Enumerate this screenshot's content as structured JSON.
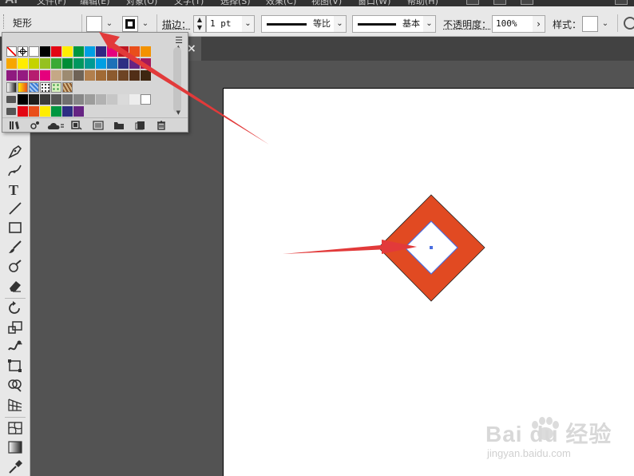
{
  "menubar": {
    "app_logo": "Ai",
    "items": [
      "文件(F)",
      "编辑(E)",
      "对象(O)",
      "文字(T)",
      "选择(S)",
      "效果(C)",
      "视图(V)",
      "窗口(W)",
      "帮助(H)"
    ]
  },
  "controlbar": {
    "tool_name": "矩形",
    "fill_color": "#ffffff",
    "stroke_label": "描边：",
    "stroke_weight": "1 pt",
    "profile_label": "等比",
    "brush_label": "基本",
    "opacity_label": "不透明度：",
    "opacity_value": "100%",
    "style_label": "样式："
  },
  "doc_tab": {
    "close_glyph": "×"
  },
  "tools": [
    "pen-tool-icon",
    "curvature-tool-icon",
    "type-tool-icon",
    "line-tool-icon",
    "rectangle-tool-icon",
    "paintbrush-tool-icon",
    "shaper-tool-icon",
    "eraser-tool-icon",
    "rotate-tool-icon",
    "scale-tool-icon",
    "warp-tool-icon",
    "free-transform-tool-icon",
    "shape-builder-tool-icon",
    "perspective-grid-tool-icon",
    "mesh-tool-icon",
    "gradient-tool-icon",
    "eyedropper-tool-icon"
  ],
  "swatch_popup": {
    "rows": [
      [
        "none",
        "registration",
        "#ffffff",
        "#000000",
        "#e30613",
        "#ffed00",
        "#009640",
        "#009fe3",
        "#312783",
        "#e6007e",
        "#be1622",
        "#e94e1b",
        "#f39200"
      ],
      [
        "#f7a600",
        "#ffed00",
        "#c5d300",
        "#95c11f",
        "#3aaa35",
        "#008d36",
        "#00975f",
        "#009a93",
        "#009fe3",
        "#1d71b8",
        "#2d2e83",
        "#662483",
        "#a3195b"
      ],
      [
        "#8f1a7f",
        "#951b81",
        "#b61d6f",
        "#e5007d",
        "#c5a886",
        "#9d8b71",
        "#6f6356",
        "#b27f4c",
        "#a16a35",
        "#8c5a2e",
        "#6e4424",
        "#512e17",
        "#3d2611"
      ],
      [
        "gradient-gray",
        "gradient-orange",
        "pattern-blue",
        "pattern-dots",
        "pattern-green",
        "pattern-brown"
      ],
      [
        "#000000",
        "#1d1d1b",
        "#3c3c3b",
        "#575756",
        "#706f6f",
        "#878787",
        "#9d9d9c",
        "#b2b2b2",
        "#c6c6c6",
        "#dadada",
        "#ededed",
        "#ffffff"
      ],
      [
        "#e30613",
        "#e94e1b",
        "#ffed00",
        "#009640",
        "#2d2e83",
        "#662483"
      ]
    ],
    "bottom_icons": [
      "swatch-libraries-icon",
      "swatch-kind-icon",
      "cloud-library-icon",
      "swatch-options-icon",
      "color-group-icon",
      "new-folder-icon",
      "new-swatch-icon",
      "delete-swatch-icon"
    ]
  },
  "artwork": {
    "outer_fill": "#e14a22",
    "inner_fill": "#ffffff",
    "selection_color": "#4a6ee0"
  },
  "annotation": {
    "arrow_color": "#e23a3a"
  },
  "watermark": {
    "brand": "Bai du 经验",
    "url": "jingyan.baidu.com"
  }
}
